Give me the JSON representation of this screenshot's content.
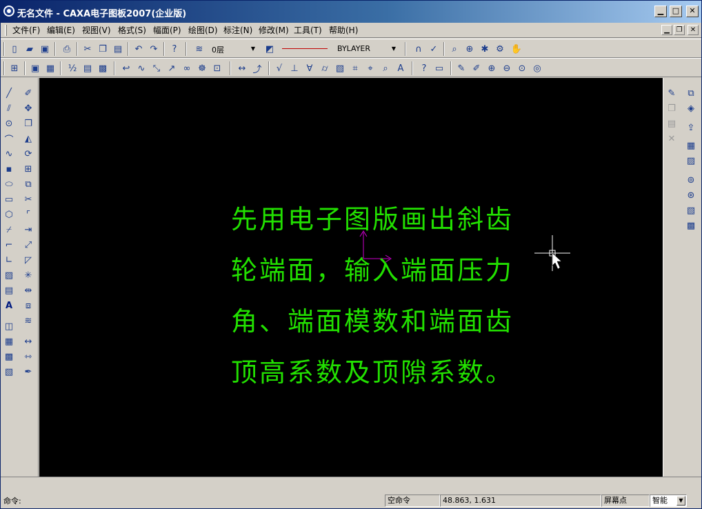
{
  "window": {
    "title": "无名文件 - CAXA电子图板2007(企业版)",
    "controls": {
      "minimize": "▁",
      "maximize": "□",
      "close": "✕"
    }
  },
  "menubar": {
    "items": [
      {
        "label": "文件(F)"
      },
      {
        "label": "编辑(E)"
      },
      {
        "label": "视图(V)"
      },
      {
        "label": "格式(S)"
      },
      {
        "label": "幅面(P)"
      },
      {
        "label": "绘图(D)"
      },
      {
        "label": "标注(N)"
      },
      {
        "label": "修改(M)"
      },
      {
        "label": "工具(T)"
      },
      {
        "label": "帮助(H)"
      }
    ],
    "mdi_controls": {
      "minimize": "▁",
      "restore": "❐",
      "close": "✕"
    }
  },
  "toolbar": {
    "layer_value": "0层",
    "linetype_value": "BYLAYER"
  },
  "canvas": {
    "lines": [
      "先用电子图版画出斜齿",
      "轮端面，输入端面压力",
      "角、端面模数和端面齿",
      "顶高系数及顶隙系数。"
    ],
    "text_color": "#22e000",
    "background_color": "#000000"
  },
  "status": {
    "prompt_label": "命令:",
    "command_state": "空命令",
    "coordinates": "48.863, 1.631",
    "snap_mode": "屏幕点",
    "snap_option": "智能"
  },
  "colors": {
    "accent": "#0a246a",
    "chrome": "#d4d0c8"
  }
}
